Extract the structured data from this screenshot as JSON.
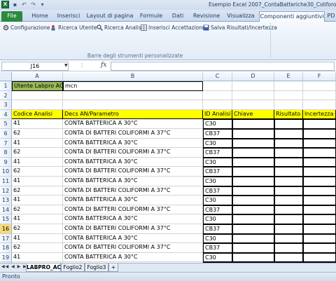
{
  "window": {
    "title": "Esempio Excel 2007_ContaBatteriche30_Coliforo"
  },
  "qat": {
    "logo": "X",
    "save": "save-icon",
    "undo": "undo-icon",
    "redo": "redo-icon",
    "more": "customize-icon"
  },
  "tabs": [
    "File",
    "Home",
    "Inserisci",
    "Layout di pagina",
    "Formule",
    "Dati",
    "Revisione",
    "Visualizza",
    "Componenti aggiuntivi",
    "PD"
  ],
  "ribbon": {
    "buttons": [
      "Configurazione",
      "Ricerca Utente",
      "Ricerca Analisi",
      "Inserisci Accettazione",
      "Salva Risultati/Incertezza"
    ],
    "group_label": "Barre degli strumenti personalizzate"
  },
  "formula_bar": {
    "name_box": "J16",
    "fx": "fx",
    "formula": ""
  },
  "columns": [
    "A",
    "B",
    "C",
    "D",
    "E",
    "F"
  ],
  "selected_row": "16",
  "rows": [
    {
      "n": "1",
      "a": "Utente Labpro AC",
      "b": "mcn",
      "c": "",
      "d": "",
      "e": "",
      "f": ""
    },
    {
      "n": "2",
      "a": "",
      "b": "",
      "c": "",
      "d": "",
      "e": "",
      "f": ""
    },
    {
      "n": "3",
      "a": "",
      "b": "",
      "c": "",
      "d": "",
      "e": "",
      "f": ""
    },
    {
      "n": "4",
      "a": "Codice Analisi",
      "b": "Decs AN/Parametro",
      "c": "ID Analisi",
      "d": "Chiave",
      "e": "Risultato",
      "f": "Incertezza"
    },
    {
      "n": "5",
      "a": "41",
      "b": "CONTA  BATTERICA A 30°C",
      "c": "C30",
      "d": "",
      "e": "",
      "f": ""
    },
    {
      "n": "6",
      "a": "62",
      "b": "CONTA DI BATTERI COLIFORMI A 37°C",
      "c": "CB37",
      "d": "",
      "e": "",
      "f": ""
    },
    {
      "n": "7",
      "a": "41",
      "b": "CONTA  BATTERICA A 30°C",
      "c": "C30",
      "d": "",
      "e": "",
      "f": ""
    },
    {
      "n": "8",
      "a": "62",
      "b": "CONTA DI BATTERI COLIFORMI A 37°C",
      "c": "CB37",
      "d": "",
      "e": "",
      "f": ""
    },
    {
      "n": "9",
      "a": "41",
      "b": "CONTA  BATTERICA A 30°C",
      "c": "C30",
      "d": "",
      "e": "",
      "f": ""
    },
    {
      "n": "10",
      "a": "62",
      "b": "CONTA DI BATTERI COLIFORMI A 37°C",
      "c": "CB37",
      "d": "",
      "e": "",
      "f": ""
    },
    {
      "n": "11",
      "a": "41",
      "b": "CONTA  BATTERICA A 30°C",
      "c": "C30",
      "d": "",
      "e": "",
      "f": ""
    },
    {
      "n": "12",
      "a": "62",
      "b": "CONTA DI BATTERI COLIFORMI A 37°C",
      "c": "CB37",
      "d": "",
      "e": "",
      "f": ""
    },
    {
      "n": "13",
      "a": "41",
      "b": "CONTA  BATTERICA A 30°C",
      "c": "C30",
      "d": "",
      "e": "",
      "f": ""
    },
    {
      "n": "14",
      "a": "62",
      "b": "CONTA DI BATTERI COLIFORMI A 37°C",
      "c": "CB37",
      "d": "",
      "e": "",
      "f": ""
    },
    {
      "n": "15",
      "a": "41",
      "b": "CONTA  BATTERICA A 30°C",
      "c": "C30",
      "d": "",
      "e": "",
      "f": ""
    },
    {
      "n": "16",
      "a": "62",
      "b": "CONTA DI BATTERI COLIFORMI A 37°C",
      "c": "CB37",
      "d": "",
      "e": "",
      "f": ""
    },
    {
      "n": "17",
      "a": "41",
      "b": "CONTA  BATTERICA A 30°C",
      "c": "C30",
      "d": "",
      "e": "",
      "f": ""
    },
    {
      "n": "18",
      "a": "62",
      "b": "CONTA DI BATTERI COLIFORMI A 37°C",
      "c": "CB37",
      "d": "",
      "e": "",
      "f": ""
    },
    {
      "n": "19",
      "a": "41",
      "b": "CONTA  BATTERICA A 30°C",
      "c": "C30",
      "d": "",
      "e": "",
      "f": ""
    },
    {
      "n": "20",
      "a": "62",
      "b": "CONTA DI BATTERI COLIFORMI A 37°C",
      "c": "CB37",
      "d": "",
      "e": "",
      "f": ""
    }
  ],
  "sheets": {
    "nav": "◀◀ ◀ ▶ ▶▶",
    "tabs": [
      "LABPRO_AC",
      "Foglio2",
      "Foglio3"
    ],
    "active": "LABPRO_AC",
    "new_sheet": "new-sheet-icon"
  },
  "status": {
    "text": "Pronto"
  },
  "colors": {
    "header_fill": "#ffff00",
    "user_fill": "#9bbb59",
    "file_tab": "#2a8a3e"
  }
}
